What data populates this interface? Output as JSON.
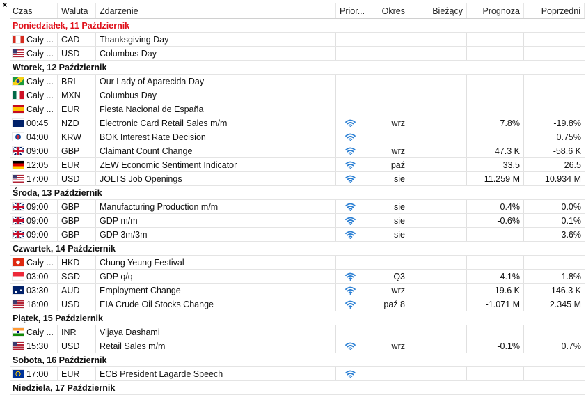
{
  "columns": {
    "time": "Czas",
    "currency": "Waluta",
    "event": "Zdarzenie",
    "priority": "Prior...",
    "period": "Okres",
    "actual": "Bieżący",
    "forecast": "Prognoza",
    "previous": "Poprzedni"
  },
  "colors": {
    "accent_red": "#e0101a",
    "wifi_blue": "#2a7fd4"
  },
  "days": [
    {
      "label": "Poniedziałek, 11 Październik",
      "highlight": true,
      "events": [
        {
          "flag": "CA",
          "time": "Cały ...",
          "cur": "CAD",
          "event": "Thanksgiving Day",
          "pri": false,
          "period": "",
          "actual": "",
          "forecast": "",
          "previous": ""
        },
        {
          "flag": "US",
          "time": "Cały ...",
          "cur": "USD",
          "event": "Columbus Day",
          "pri": false,
          "period": "",
          "actual": "",
          "forecast": "",
          "previous": ""
        }
      ]
    },
    {
      "label": "Wtorek, 12 Październik",
      "highlight": false,
      "events": [
        {
          "flag": "BR",
          "time": "Cały ...",
          "cur": "BRL",
          "event": "Our Lady of Aparecida Day",
          "pri": false,
          "period": "",
          "actual": "",
          "forecast": "",
          "previous": ""
        },
        {
          "flag": "MX",
          "time": "Cały ...",
          "cur": "MXN",
          "event": "Columbus Day",
          "pri": false,
          "period": "",
          "actual": "",
          "forecast": "",
          "previous": ""
        },
        {
          "flag": "ES",
          "time": "Cały ...",
          "cur": "EUR",
          "event": "Fiesta Nacional de España",
          "pri": false,
          "period": "",
          "actual": "",
          "forecast": "",
          "previous": ""
        },
        {
          "flag": "NZ",
          "time": "00:45",
          "cur": "NZD",
          "event": "Electronic Card Retail Sales m/m",
          "pri": true,
          "period": "wrz",
          "actual": "",
          "forecast": "7.8%",
          "previous": "-19.8%"
        },
        {
          "flag": "KR",
          "time": "04:00",
          "cur": "KRW",
          "event": "BOK Interest Rate Decision",
          "pri": true,
          "period": "",
          "actual": "",
          "forecast": "",
          "previous": "0.75%"
        },
        {
          "flag": "GB",
          "time": "09:00",
          "cur": "GBP",
          "event": "Claimant Count Change",
          "pri": true,
          "period": "wrz",
          "actual": "",
          "forecast": "47.3 K",
          "previous": "-58.6 K"
        },
        {
          "flag": "DE",
          "time": "12:05",
          "cur": "EUR",
          "event": "ZEW Economic Sentiment Indicator",
          "pri": true,
          "period": "paź",
          "actual": "",
          "forecast": "33.5",
          "previous": "26.5"
        },
        {
          "flag": "US",
          "time": "17:00",
          "cur": "USD",
          "event": "JOLTS Job Openings",
          "pri": true,
          "period": "sie",
          "actual": "",
          "forecast": "11.259 M",
          "previous": "10.934 M"
        }
      ]
    },
    {
      "label": "Środa, 13 Październik",
      "highlight": false,
      "events": [
        {
          "flag": "GB",
          "time": "09:00",
          "cur": "GBP",
          "event": "Manufacturing Production m/m",
          "pri": true,
          "period": "sie",
          "actual": "",
          "forecast": "0.4%",
          "previous": "0.0%"
        },
        {
          "flag": "GB",
          "time": "09:00",
          "cur": "GBP",
          "event": "GDP m/m",
          "pri": true,
          "period": "sie",
          "actual": "",
          "forecast": "-0.6%",
          "previous": "0.1%"
        },
        {
          "flag": "GB",
          "time": "09:00",
          "cur": "GBP",
          "event": "GDP 3m/3m",
          "pri": true,
          "period": "sie",
          "actual": "",
          "forecast": "",
          "previous": "3.6%"
        }
      ]
    },
    {
      "label": "Czwartek, 14 Październik",
      "highlight": false,
      "events": [
        {
          "flag": "HK",
          "time": "Cały ...",
          "cur": "HKD",
          "event": "Chung Yeung Festival",
          "pri": false,
          "period": "",
          "actual": "",
          "forecast": "",
          "previous": ""
        },
        {
          "flag": "SG",
          "time": "03:00",
          "cur": "SGD",
          "event": "GDP q/q",
          "pri": true,
          "period": "Q3",
          "actual": "",
          "forecast": "-4.1%",
          "previous": "-1.8%"
        },
        {
          "flag": "AU",
          "time": "03:30",
          "cur": "AUD",
          "event": "Employment Change",
          "pri": true,
          "period": "wrz",
          "actual": "",
          "forecast": "-19.6 K",
          "previous": "-146.3 K"
        },
        {
          "flag": "US",
          "time": "18:00",
          "cur": "USD",
          "event": "EIA Crude Oil Stocks Change",
          "pri": true,
          "period": "paź 8",
          "actual": "",
          "forecast": "-1.071 M",
          "previous": "2.345 M"
        }
      ]
    },
    {
      "label": "Piątek, 15 Październik",
      "highlight": false,
      "events": [
        {
          "flag": "IN",
          "time": "Cały ...",
          "cur": "INR",
          "event": "Vijaya Dashami",
          "pri": false,
          "period": "",
          "actual": "",
          "forecast": "",
          "previous": ""
        },
        {
          "flag": "US",
          "time": "15:30",
          "cur": "USD",
          "event": "Retail Sales m/m",
          "pri": true,
          "period": "wrz",
          "actual": "",
          "forecast": "-0.1%",
          "previous": "0.7%"
        }
      ]
    },
    {
      "label": "Sobota, 16 Październik",
      "highlight": false,
      "events": [
        {
          "flag": "EU",
          "time": "17:00",
          "cur": "EUR",
          "event": "ECB President Lagarde Speech",
          "pri": true,
          "period": "",
          "actual": "",
          "forecast": "",
          "previous": ""
        }
      ]
    },
    {
      "label": "Niedziela, 17 Październik",
      "highlight": false,
      "events": []
    }
  ]
}
